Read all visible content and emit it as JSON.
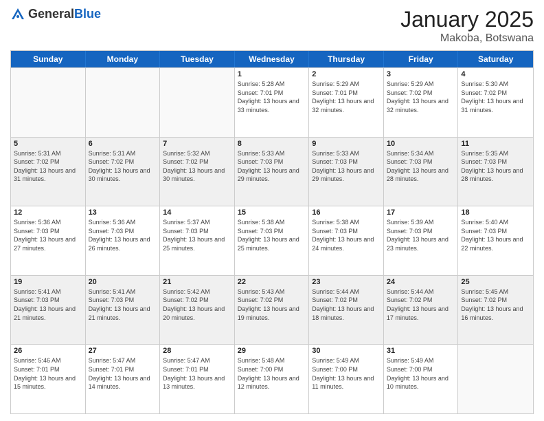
{
  "header": {
    "logo_general": "General",
    "logo_blue": "Blue",
    "month_title": "January 2025",
    "location": "Makoba, Botswana"
  },
  "day_headers": [
    "Sunday",
    "Monday",
    "Tuesday",
    "Wednesday",
    "Thursday",
    "Friday",
    "Saturday"
  ],
  "weeks": [
    {
      "shade": false,
      "days": [
        {
          "num": "",
          "empty": true
        },
        {
          "num": "",
          "empty": true
        },
        {
          "num": "",
          "empty": true
        },
        {
          "num": "1",
          "sunrise": "5:28 AM",
          "sunset": "7:01 PM",
          "daylight": "13 hours and 33 minutes."
        },
        {
          "num": "2",
          "sunrise": "5:29 AM",
          "sunset": "7:01 PM",
          "daylight": "13 hours and 32 minutes."
        },
        {
          "num": "3",
          "sunrise": "5:29 AM",
          "sunset": "7:02 PM",
          "daylight": "13 hours and 32 minutes."
        },
        {
          "num": "4",
          "sunrise": "5:30 AM",
          "sunset": "7:02 PM",
          "daylight": "13 hours and 31 minutes."
        }
      ]
    },
    {
      "shade": true,
      "days": [
        {
          "num": "5",
          "sunrise": "5:31 AM",
          "sunset": "7:02 PM",
          "daylight": "13 hours and 31 minutes."
        },
        {
          "num": "6",
          "sunrise": "5:31 AM",
          "sunset": "7:02 PM",
          "daylight": "13 hours and 30 minutes."
        },
        {
          "num": "7",
          "sunrise": "5:32 AM",
          "sunset": "7:02 PM",
          "daylight": "13 hours and 30 minutes."
        },
        {
          "num": "8",
          "sunrise": "5:33 AM",
          "sunset": "7:03 PM",
          "daylight": "13 hours and 29 minutes."
        },
        {
          "num": "9",
          "sunrise": "5:33 AM",
          "sunset": "7:03 PM",
          "daylight": "13 hours and 29 minutes."
        },
        {
          "num": "10",
          "sunrise": "5:34 AM",
          "sunset": "7:03 PM",
          "daylight": "13 hours and 28 minutes."
        },
        {
          "num": "11",
          "sunrise": "5:35 AM",
          "sunset": "7:03 PM",
          "daylight": "13 hours and 28 minutes."
        }
      ]
    },
    {
      "shade": false,
      "days": [
        {
          "num": "12",
          "sunrise": "5:36 AM",
          "sunset": "7:03 PM",
          "daylight": "13 hours and 27 minutes."
        },
        {
          "num": "13",
          "sunrise": "5:36 AM",
          "sunset": "7:03 PM",
          "daylight": "13 hours and 26 minutes."
        },
        {
          "num": "14",
          "sunrise": "5:37 AM",
          "sunset": "7:03 PM",
          "daylight": "13 hours and 25 minutes."
        },
        {
          "num": "15",
          "sunrise": "5:38 AM",
          "sunset": "7:03 PM",
          "daylight": "13 hours and 25 minutes."
        },
        {
          "num": "16",
          "sunrise": "5:38 AM",
          "sunset": "7:03 PM",
          "daylight": "13 hours and 24 minutes."
        },
        {
          "num": "17",
          "sunrise": "5:39 AM",
          "sunset": "7:03 PM",
          "daylight": "13 hours and 23 minutes."
        },
        {
          "num": "18",
          "sunrise": "5:40 AM",
          "sunset": "7:03 PM",
          "daylight": "13 hours and 22 minutes."
        }
      ]
    },
    {
      "shade": true,
      "days": [
        {
          "num": "19",
          "sunrise": "5:41 AM",
          "sunset": "7:03 PM",
          "daylight": "13 hours and 21 minutes."
        },
        {
          "num": "20",
          "sunrise": "5:41 AM",
          "sunset": "7:03 PM",
          "daylight": "13 hours and 21 minutes."
        },
        {
          "num": "21",
          "sunrise": "5:42 AM",
          "sunset": "7:02 PM",
          "daylight": "13 hours and 20 minutes."
        },
        {
          "num": "22",
          "sunrise": "5:43 AM",
          "sunset": "7:02 PM",
          "daylight": "13 hours and 19 minutes."
        },
        {
          "num": "23",
          "sunrise": "5:44 AM",
          "sunset": "7:02 PM",
          "daylight": "13 hours and 18 minutes."
        },
        {
          "num": "24",
          "sunrise": "5:44 AM",
          "sunset": "7:02 PM",
          "daylight": "13 hours and 17 minutes."
        },
        {
          "num": "25",
          "sunrise": "5:45 AM",
          "sunset": "7:02 PM",
          "daylight": "13 hours and 16 minutes."
        }
      ]
    },
    {
      "shade": false,
      "days": [
        {
          "num": "26",
          "sunrise": "5:46 AM",
          "sunset": "7:01 PM",
          "daylight": "13 hours and 15 minutes."
        },
        {
          "num": "27",
          "sunrise": "5:47 AM",
          "sunset": "7:01 PM",
          "daylight": "13 hours and 14 minutes."
        },
        {
          "num": "28",
          "sunrise": "5:47 AM",
          "sunset": "7:01 PM",
          "daylight": "13 hours and 13 minutes."
        },
        {
          "num": "29",
          "sunrise": "5:48 AM",
          "sunset": "7:00 PM",
          "daylight": "13 hours and 12 minutes."
        },
        {
          "num": "30",
          "sunrise": "5:49 AM",
          "sunset": "7:00 PM",
          "daylight": "13 hours and 11 minutes."
        },
        {
          "num": "31",
          "sunrise": "5:49 AM",
          "sunset": "7:00 PM",
          "daylight": "13 hours and 10 minutes."
        },
        {
          "num": "",
          "empty": true
        }
      ]
    }
  ]
}
